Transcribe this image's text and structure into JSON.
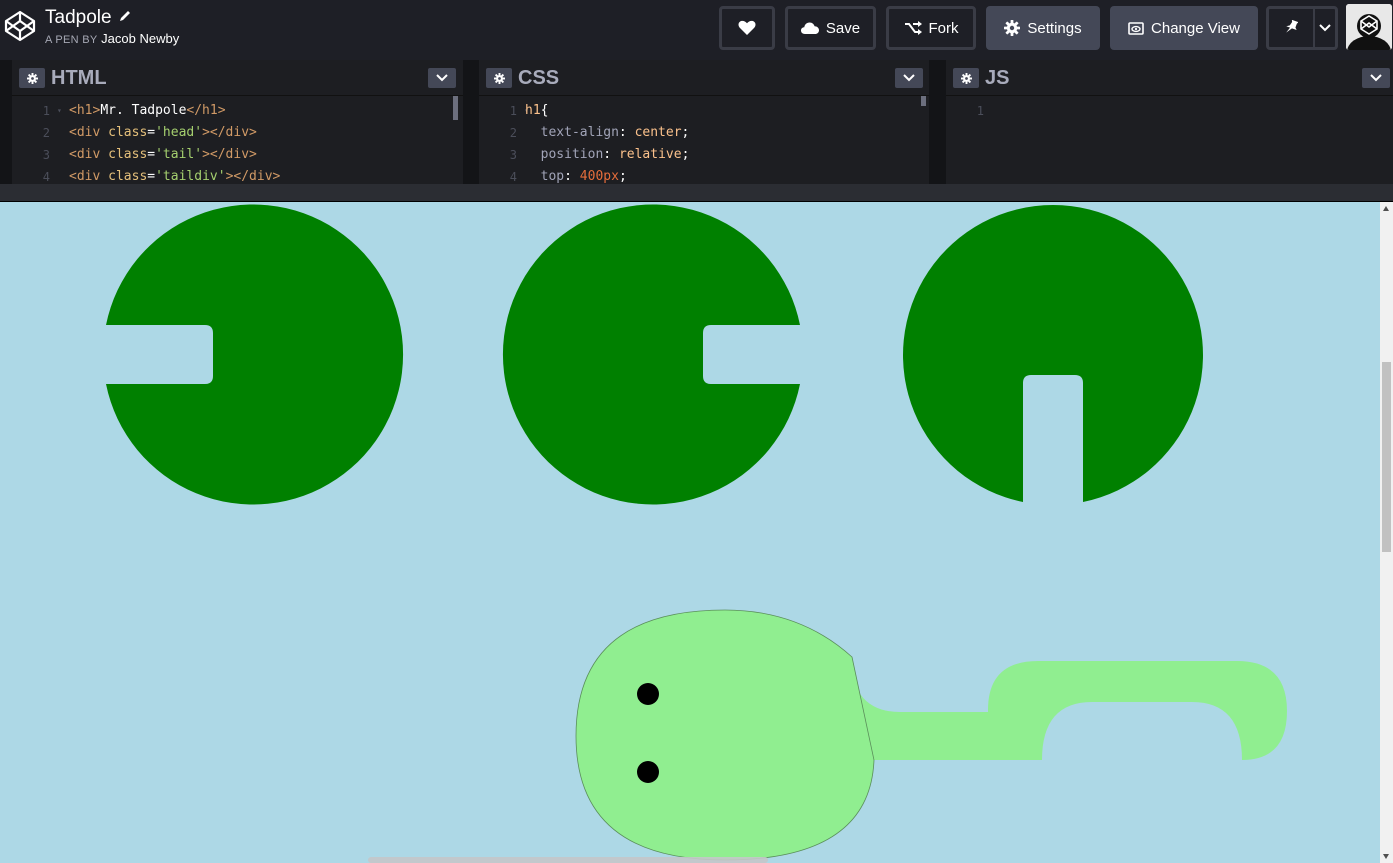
{
  "header": {
    "pen_title": "Tadpole",
    "byline_prefix": "A PEN BY",
    "author": "Jacob Newby",
    "buttons": {
      "save": "Save",
      "fork": "Fork",
      "settings": "Settings",
      "change_view": "Change View"
    },
    "icons": [
      "codepen-logo-icon",
      "pencil-icon",
      "heart-icon",
      "cloud-icon",
      "fork-icon",
      "gear-icon",
      "change-view-icon",
      "pin-icon",
      "chevron-down-icon"
    ]
  },
  "editors": {
    "html": {
      "title": "HTML",
      "lines": [
        {
          "n": "1",
          "parts": [
            [
              "t-tag",
              "<h1>"
            ],
            [
              "t-sel",
              "Mr. Tadpole"
            ],
            [
              "t-tag",
              "</h1>"
            ]
          ]
        },
        {
          "n": "2",
          "parts": [
            [
              "t-tag",
              "<div "
            ],
            [
              "t-attr",
              "class"
            ],
            [
              "t-sel",
              "="
            ],
            [
              "t-str",
              "'head'"
            ],
            [
              "t-tag",
              "></div>"
            ]
          ]
        },
        {
          "n": "3",
          "parts": [
            [
              "t-tag",
              "<div "
            ],
            [
              "t-attr",
              "class"
            ],
            [
              "t-sel",
              "="
            ],
            [
              "t-str",
              "'tail'"
            ],
            [
              "t-tag",
              "></div>"
            ]
          ]
        },
        {
          "n": "4",
          "parts": [
            [
              "t-tag",
              "<div "
            ],
            [
              "t-attr",
              "class"
            ],
            [
              "t-sel",
              "="
            ],
            [
              "t-str",
              "'taildiv'"
            ],
            [
              "t-tag",
              "></div>"
            ]
          ]
        }
      ]
    },
    "css": {
      "title": "CSS",
      "lines": [
        {
          "n": "1",
          "parts": [
            [
              "t-val",
              "h1"
            ],
            [
              "t-sel",
              "{"
            ]
          ]
        },
        {
          "n": "2",
          "parts": [
            [
              "t-prop",
              "  text-align"
            ],
            [
              "t-sel",
              ": "
            ],
            [
              "t-val",
              "center"
            ],
            [
              "t-sel",
              ";"
            ]
          ]
        },
        {
          "n": "3",
          "parts": [
            [
              "t-prop",
              "  position"
            ],
            [
              "t-sel",
              ": "
            ],
            [
              "t-val",
              "relative"
            ],
            [
              "t-sel",
              ";"
            ]
          ]
        },
        {
          "n": "4",
          "parts": [
            [
              "t-prop",
              "  top"
            ],
            [
              "t-sel",
              ": "
            ],
            [
              "t-num",
              "400px"
            ],
            [
              "t-sel",
              ";"
            ]
          ]
        }
      ]
    },
    "js": {
      "title": "JS",
      "lines": [
        {
          "n": "1",
          "parts": []
        }
      ]
    }
  },
  "preview": {
    "background": "#add8e6",
    "pad_color": "#008000",
    "tadpole_color": "#90ee90",
    "eye_color": "#000000"
  }
}
